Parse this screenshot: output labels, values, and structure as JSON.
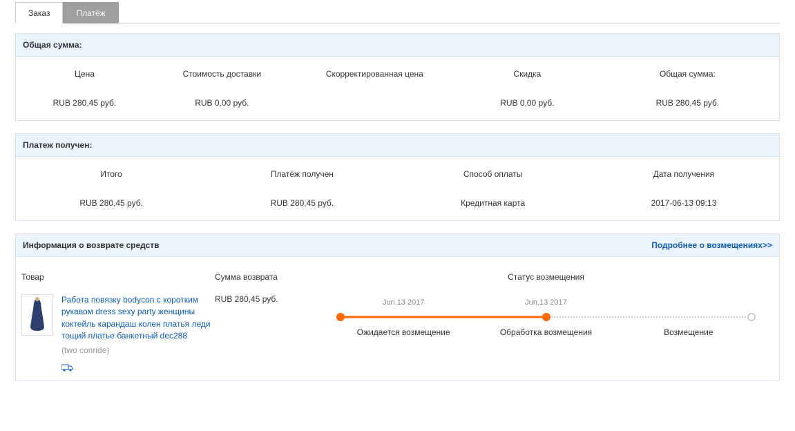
{
  "tabs": {
    "order": "Заказ",
    "payment": "Платёж"
  },
  "totals_panel": {
    "title": "Общая сумма:",
    "headers": {
      "price": "Цена",
      "shipping": "Стоимость доставки",
      "adjusted": "Скорректированная цена",
      "discount": "Скидка",
      "total": "Общая сумма:"
    },
    "values": {
      "price": "RUB 280,45 руб.",
      "shipping": "RUB 0,00 руб.",
      "adjusted": "",
      "discount": "RUB 0,00 руб.",
      "total": "RUB 280,45 руб."
    }
  },
  "received_panel": {
    "title": "Платеж получен:",
    "headers": {
      "total": "Итого",
      "received": "Платёж получен",
      "method": "Способ оплаты",
      "date": "Дата получения"
    },
    "values": {
      "total": "RUB 280,45 руб.",
      "received": "RUB 280,45 руб.",
      "method": "Кредитная карта",
      "date": "2017-06-13 09:13"
    }
  },
  "refund_panel": {
    "title": "Информация о возврате средств",
    "more_link": "Подробнее о возмещениях>>",
    "headers": {
      "product": "Товар",
      "amount": "Сумма возврата",
      "status": "Статус возмещения"
    },
    "product": {
      "name": "Работа повязку bodycon с коротким рукавом dress sexy party женщины коктейль карандаш колен платья леди тощий платье банкетный dec288",
      "sku": "(two conride)"
    },
    "amount": "RUB 280,45 руб.",
    "timeline": {
      "dates": {
        "d1": "Jun.13 2017",
        "d2": "Jun.13 2017",
        "d3": ""
      },
      "labels": {
        "l1": "Ожидается возмещение",
        "l2": "Обработка возмещения",
        "l3": "Возмещение"
      },
      "progress_pct": 50
    }
  }
}
